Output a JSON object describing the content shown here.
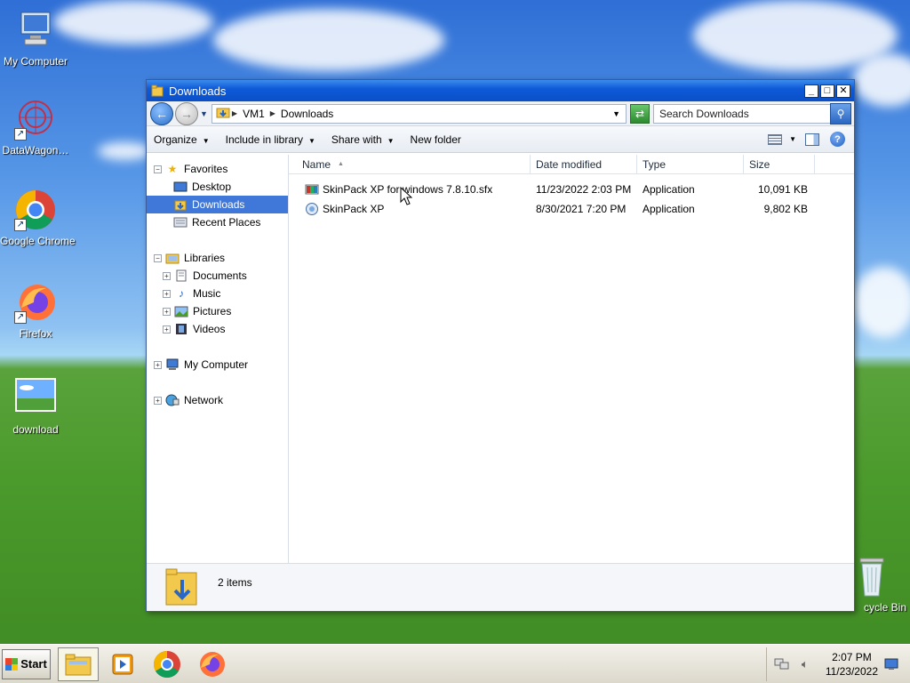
{
  "desktop": {
    "icons": [
      {
        "label": "My Computer"
      },
      {
        "label": "DataWagon…"
      },
      {
        "label": "Google Chrome"
      },
      {
        "label": "Firefox"
      },
      {
        "label": "download"
      },
      {
        "label": "cycle Bin"
      }
    ]
  },
  "window": {
    "title": "Downloads",
    "address": {
      "root": "VM1",
      "current": "Downloads"
    },
    "search_placeholder": "Search Downloads",
    "toolbar": {
      "organize": "Organize",
      "include_in_library": "Include in library",
      "share_with": "Share with",
      "new_folder": "New folder"
    },
    "nav": {
      "favorites": "Favorites",
      "desktop": "Desktop",
      "downloads": "Downloads",
      "recent_places": "Recent Places",
      "libraries": "Libraries",
      "documents": "Documents",
      "music": "Music",
      "pictures": "Pictures",
      "videos": "Videos",
      "my_computer": "My Computer",
      "network": "Network"
    },
    "columns": {
      "name": "Name",
      "date": "Date modified",
      "type": "Type",
      "size": "Size"
    },
    "files": [
      {
        "name": "SkinPack XP for windows 7.8.10.sfx",
        "date": "11/23/2022 2:03 PM",
        "type": "Application",
        "size": "10,091 KB"
      },
      {
        "name": "SkinPack XP",
        "date": "8/30/2021 7:20 PM",
        "type": "Application",
        "size": "9,802 KB"
      }
    ],
    "status": "2 items"
  },
  "taskbar": {
    "start": "Start",
    "time": "2:07 PM",
    "date": "11/23/2022"
  }
}
